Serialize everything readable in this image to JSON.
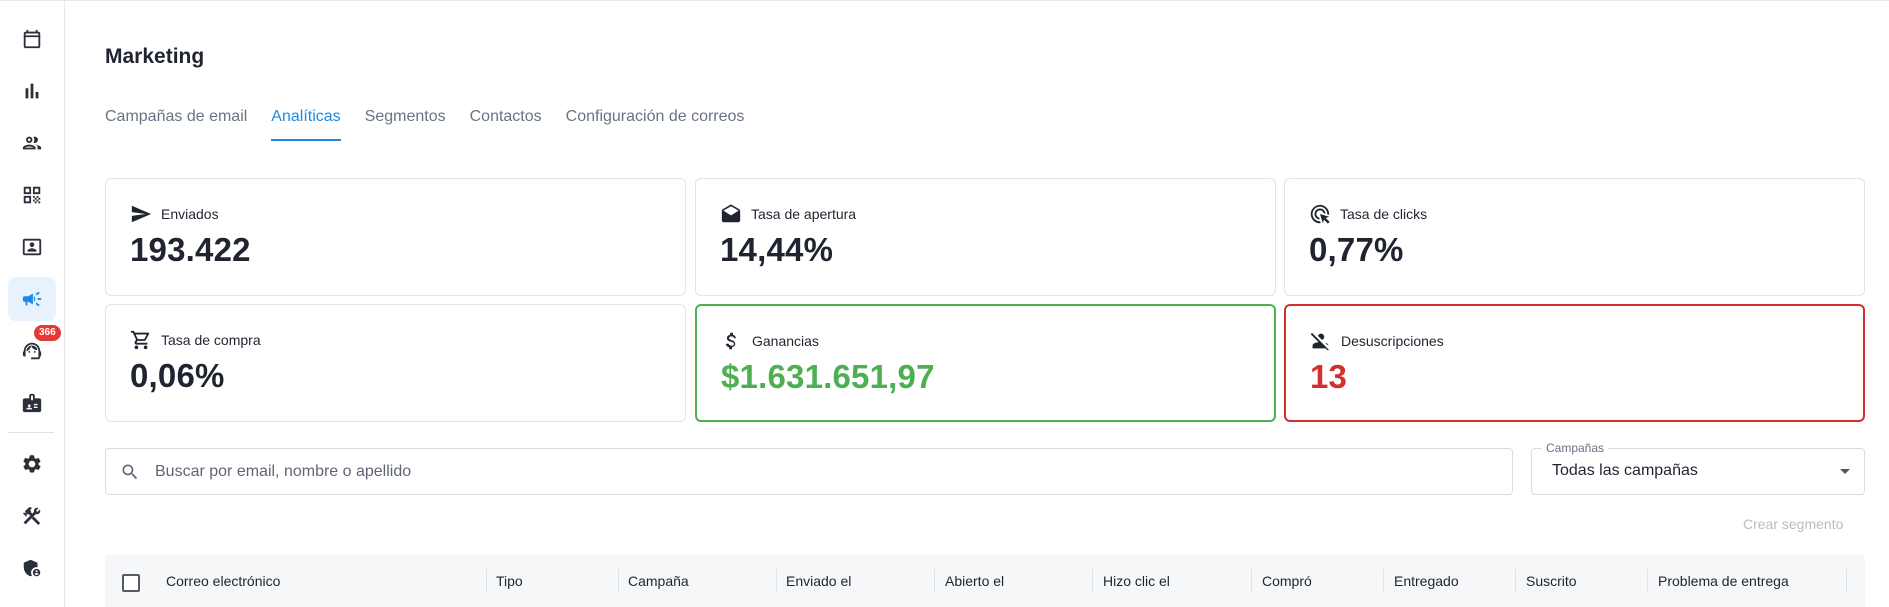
{
  "sidebar": {
    "items": [
      {
        "icon": "calendar-icon"
      },
      {
        "icon": "bar-chart-icon"
      },
      {
        "icon": "people-icon"
      },
      {
        "icon": "qr-code-icon"
      },
      {
        "icon": "contact-card-icon"
      },
      {
        "icon": "campaign-icon",
        "active": true
      },
      {
        "icon": "support-agent-icon",
        "badge": "366"
      },
      {
        "icon": "badge-icon"
      },
      {
        "icon": "gear-icon"
      },
      {
        "icon": "tools-icon"
      },
      {
        "icon": "admin-shield-icon"
      }
    ]
  },
  "page": {
    "title": "Marketing"
  },
  "tabs": [
    {
      "label": "Campañas de email"
    },
    {
      "label": "Analíticas",
      "active": true
    },
    {
      "label": "Segmentos"
    },
    {
      "label": "Contactos"
    },
    {
      "label": "Configuración de correos"
    }
  ],
  "stats": {
    "sent": {
      "label": "Enviados",
      "value": "193.422",
      "icon": "send-icon"
    },
    "open_rate": {
      "label": "Tasa de apertura",
      "value": "14,44%",
      "icon": "drafts-icon"
    },
    "click_rate": {
      "label": "Tasa de clicks",
      "value": "0,77%",
      "icon": "ads-click-icon"
    },
    "purchase_rate": {
      "label": "Tasa de compra",
      "value": "0,06%",
      "icon": "cart-icon"
    },
    "revenue": {
      "label": "Ganancias",
      "value": "$1.631.651,97",
      "icon": "dollar-icon",
      "accent": "#4caf50"
    },
    "unsubscribes": {
      "label": "Desuscripciones",
      "value": "13",
      "icon": "person-off-icon",
      "accent": "#d32f2f"
    }
  },
  "search": {
    "placeholder": "Buscar por email, nombre o apellido"
  },
  "campaign_filter": {
    "label": "Campañas",
    "value": "Todas las campañas"
  },
  "create_segment": {
    "label": "Crear segmento"
  },
  "table": {
    "columns": [
      "Correo electrónico",
      "Tipo",
      "Campaña",
      "Enviado el",
      "Abierto el",
      "Hizo clic el",
      "Compró",
      "Entregado",
      "Suscrito",
      "Problema de entrega"
    ]
  },
  "colors": {
    "accent": "#1e88e5",
    "success": "#4caf50",
    "danger": "#d32f2f",
    "badge": "#e53935"
  }
}
